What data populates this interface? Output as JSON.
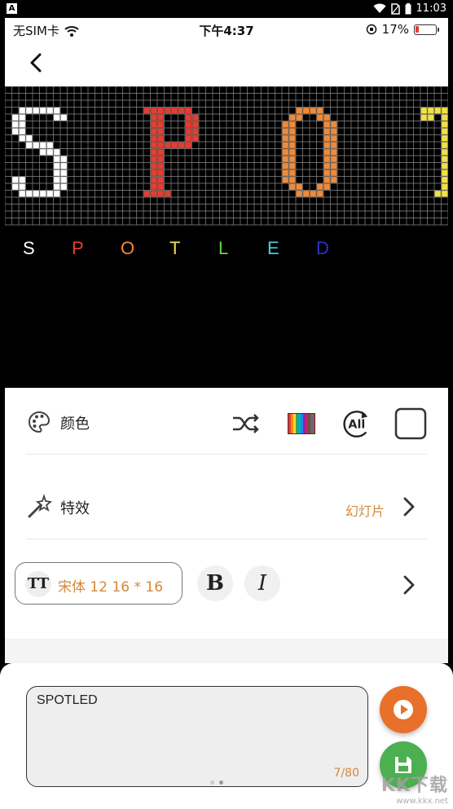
{
  "android_status": {
    "time": "11:03"
  },
  "ios_status": {
    "carrier": "无SIM卡",
    "time": "下午4:37",
    "battery": "17%",
    "battery_level": 0.17
  },
  "preview_letters": [
    {
      "char": "S",
      "color": "#ffffff"
    },
    {
      "char": "P",
      "color": "#e53d31"
    },
    {
      "char": "O",
      "color": "#ef8a3a"
    },
    {
      "char": "T",
      "color": "#f2e04a"
    },
    {
      "char": "L",
      "color": "#6bd24a"
    },
    {
      "char": "E",
      "color": "#4ecbd6"
    },
    {
      "char": "D",
      "color": "#2b32c8"
    }
  ],
  "led_colors": {
    "S": "#ffffff",
    "P": "#e53d31",
    "O": "#ef8a3a",
    "T": "#f2e04a"
  },
  "color_row": {
    "label": "颜色",
    "icons": [
      "shuffle-icon",
      "rainbow-gradient-icon",
      "all-cycle-icon",
      "square-outline-icon"
    ],
    "all_text": "All"
  },
  "effect_row": {
    "label": "特效",
    "value": "幻灯片"
  },
  "font_row": {
    "tt_icon": "TT",
    "font_text": "宋体  12  16 * 16",
    "bold": "B",
    "italic": "I"
  },
  "input": {
    "value": "SPOTLED",
    "counter": "7/80"
  },
  "buttons": {
    "play": "play-icon",
    "save": "save-icon"
  },
  "watermark": {
    "text": "KK下载",
    "url": "www.kkx.net"
  },
  "colors": {
    "accent": "#d4883a",
    "play_bg": "#e8702a",
    "save_bg": "#4caf50"
  }
}
